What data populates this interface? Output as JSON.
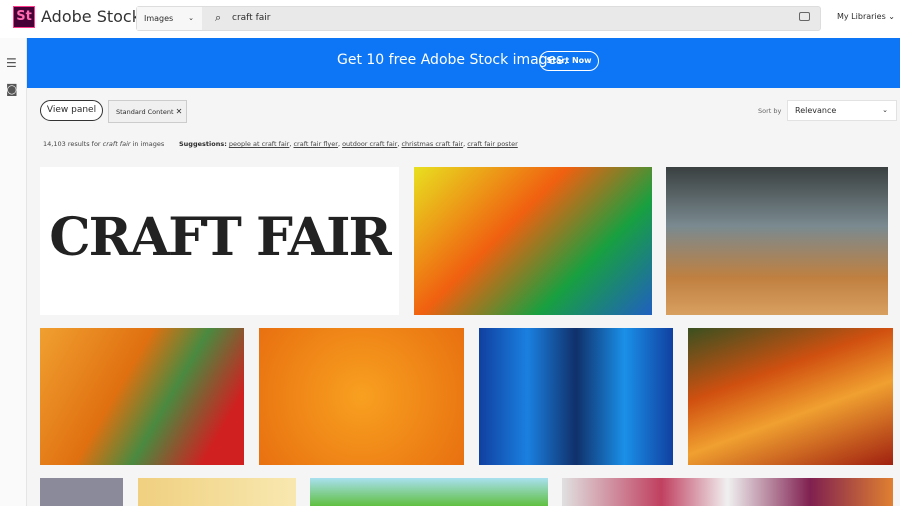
{
  "header": {
    "logo": "St",
    "brand": "Adobe Stock",
    "search_type": "Images",
    "search_query": "craft fair",
    "my_libraries": "My Libraries"
  },
  "banner": {
    "text": "Get 10 free Adobe Stock images.",
    "button": "Start Now",
    "color": "#0d76f7"
  },
  "filters": {
    "view_panel": "View panel",
    "chip": "Standard Content",
    "sort_label": "Sort by",
    "sort_value": "Relevance"
  },
  "results": {
    "count": "14,103",
    "pre": " results for ",
    "query": "craft fair",
    "post": " in images"
  },
  "suggestions": {
    "label": "Suggestions:",
    "items": [
      "people at craft fair",
      "craft fair flyer",
      "outdoor craft fair",
      "christmas craft fair",
      "craft fair poster"
    ]
  },
  "images": {
    "first_logo_text": "CRAFT FAIR"
  }
}
